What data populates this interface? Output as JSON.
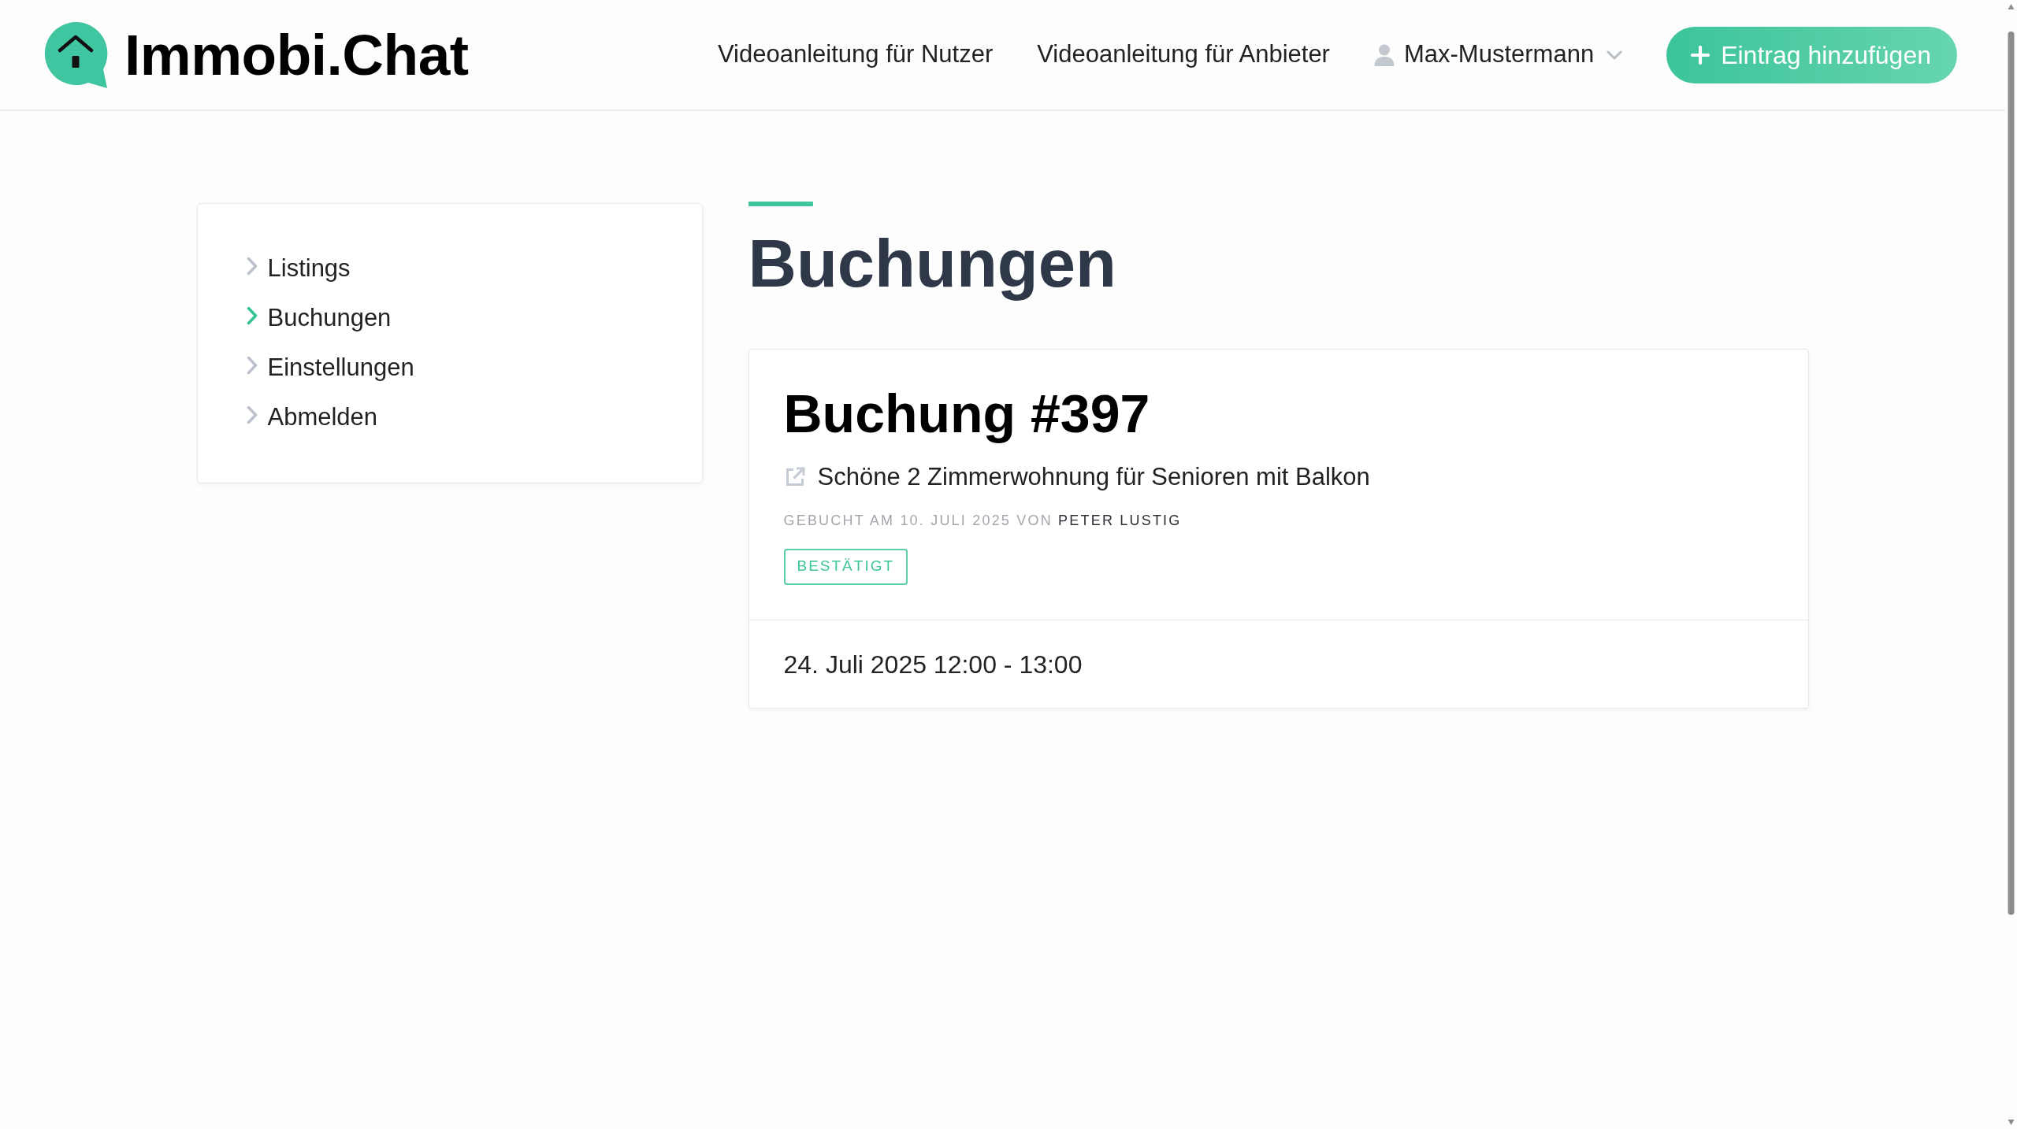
{
  "header": {
    "logo_text": "Immobi.Chat",
    "nav_links": [
      "Videoanleitung für Nutzer",
      "Videoanleitung für Anbieter"
    ],
    "user_menu": {
      "label": "Max-Mustermann"
    },
    "add_button": {
      "label": "Eintrag hinzufügen"
    }
  },
  "sidebar": {
    "items": [
      {
        "label": "Listings",
        "selected": false
      },
      {
        "label": "Buchungen",
        "selected": true
      },
      {
        "label": "Einstellungen",
        "selected": false
      },
      {
        "label": "Abmelden",
        "selected": false
      }
    ]
  },
  "page": {
    "title": "Buchungen"
  },
  "bookings": [
    {
      "title": "Buchung #397",
      "listing": "Schöne 2 Zimmerwohnung für Senioren mit Balkon",
      "booked_text": "GEBUCHT AM 10. JULI 2025 VON",
      "booked_by": "PETER LUSTIG",
      "status": {
        "label": "BESTÄTIGT",
        "kind": "confirmed"
      },
      "time_slot": "24. Juli 2025 12:00 - 13:00"
    }
  ]
}
